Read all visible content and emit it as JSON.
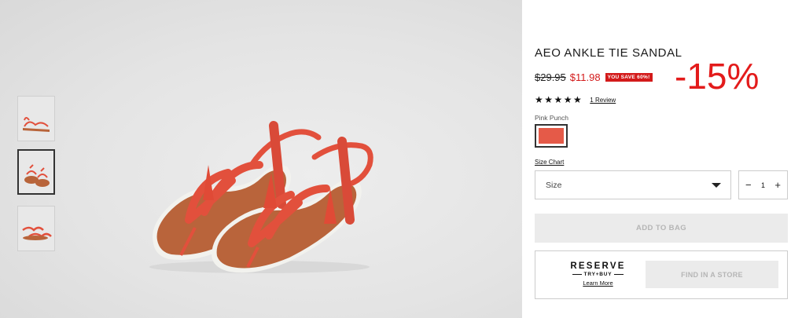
{
  "product": {
    "title": "AEO ANKLE TIE SANDAL",
    "old_price": "$29.95",
    "new_price": "$11.98",
    "save_badge": "YOU SAVE 60%!",
    "discount_overlay": "-15%",
    "stars": "★★★★★",
    "rating_value": 5,
    "review_link": "1 Review",
    "color_label": "Pink Punch",
    "size_chart": "Size Chart",
    "size_placeholder": "Size",
    "quantity": "1",
    "qty_minus": "−",
    "qty_plus": "+",
    "add_to_bag": "ADD TO BAG",
    "reserve_title": "RESERVE",
    "reserve_sub": "TRY+BUY",
    "learn_more": "Learn More",
    "find_in_store": "FIND IN A STORE"
  },
  "colors": {
    "accent_red": "#d31a1a",
    "swatch": "#e55a48",
    "disabled_bg": "#ebebeb"
  },
  "thumbnails": [
    "sandal-side-view",
    "sandal-pair-top-view",
    "sandal-pair-flat-view"
  ]
}
